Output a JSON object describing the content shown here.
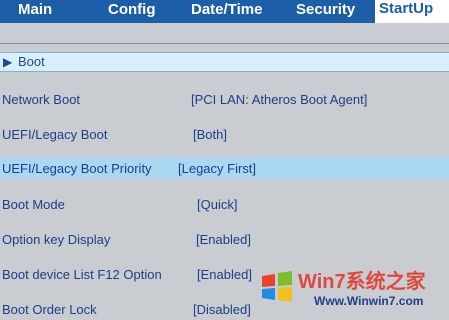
{
  "tabs": [
    {
      "label": "Main",
      "active": false
    },
    {
      "label": "Config",
      "active": false
    },
    {
      "label": "Date/Time",
      "active": false
    },
    {
      "label": "Security",
      "active": false
    },
    {
      "label": "StartUp",
      "active": true
    }
  ],
  "section": {
    "label": "Boot",
    "icon": "triangle-right-icon"
  },
  "settings": [
    {
      "name": "Network Boot",
      "value": "[PCI LAN: Atheros Boot Agent]"
    },
    {
      "name": "UEFI/Legacy Boot",
      "value": "[Both]"
    },
    {
      "name": "UEFI/Legacy Boot Priority",
      "value": "[Legacy First]",
      "selected": true
    },
    {
      "name": "Boot Mode",
      "value": "[Quick]"
    },
    {
      "name": "Option key Display",
      "value": "[Enabled]"
    },
    {
      "name": "Boot device List F12 Option",
      "value": "[Enabled]"
    },
    {
      "name": "Boot Order Lock",
      "value": "[Disabled]"
    }
  ],
  "watermark": {
    "text": "Win7系统之家",
    "url": "Www.Winwin7.com"
  },
  "colors": {
    "tabbar": "#1c5fa8",
    "background": "#c9ccd1",
    "highlight": "#a9d8f3",
    "section": "#dbeefb",
    "text": "#1c3f86"
  }
}
